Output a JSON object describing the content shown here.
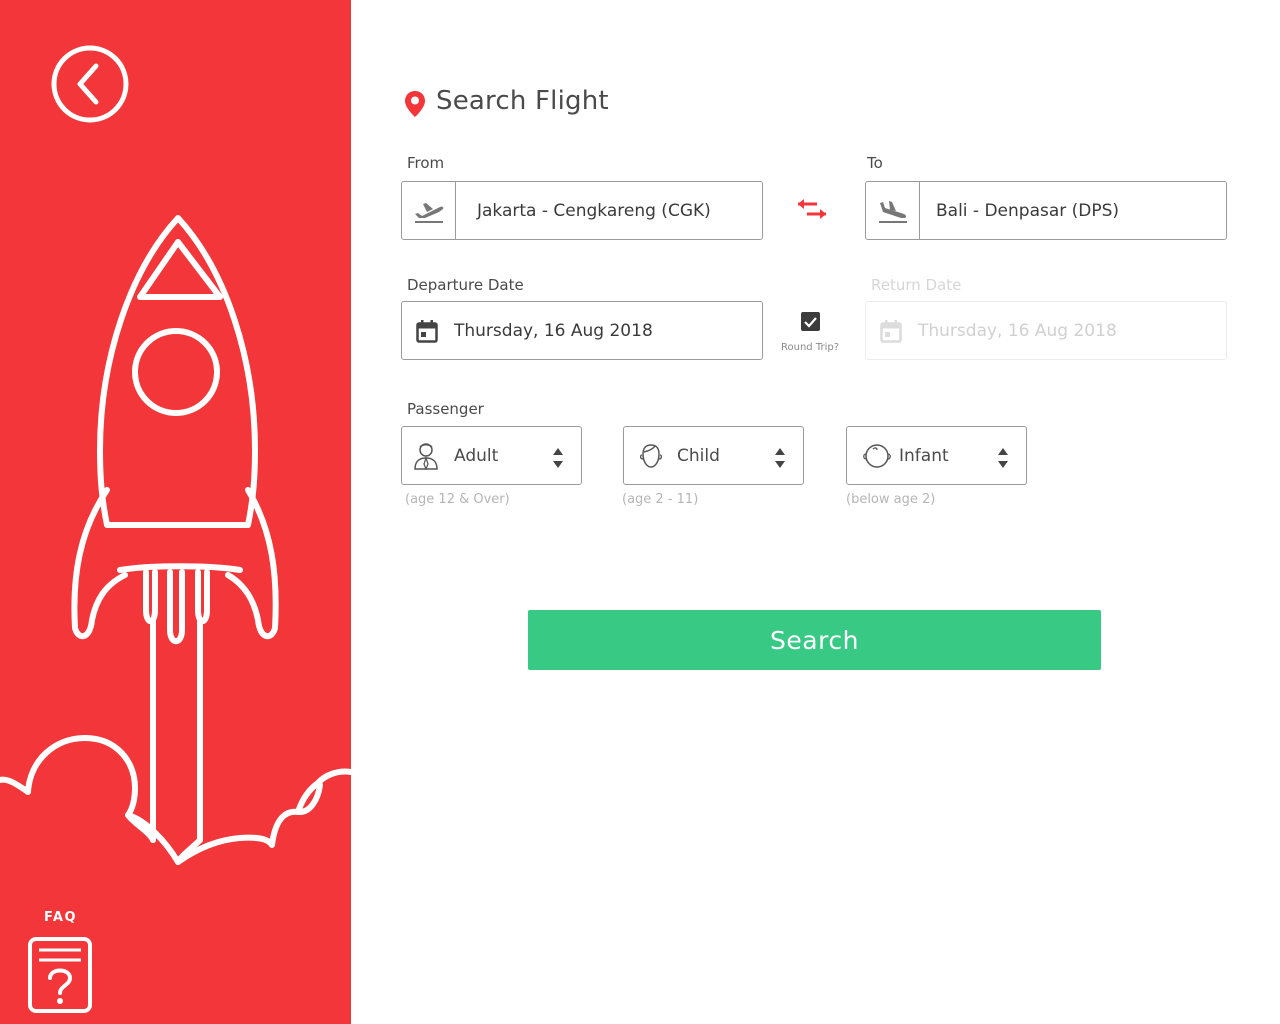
{
  "sidebar": {
    "faq_label": "FAQ"
  },
  "page": {
    "title": "Search Flight"
  },
  "from": {
    "label": "From",
    "value": "Jakarta - Cengkareng (CGK)"
  },
  "to": {
    "label": "To",
    "value": "Bali - Denpasar (DPS)"
  },
  "departure": {
    "label": "Departure Date",
    "value": "Thursday, 16 Aug 2018"
  },
  "round_trip": {
    "label": "Round Trip?",
    "checked": true
  },
  "return": {
    "label": "Return Date",
    "value": "Thursday, 16 Aug 2018",
    "disabled": true
  },
  "passenger": {
    "label": "Passenger",
    "adult": {
      "label": "Adult",
      "hint": "(age 12 & Over)"
    },
    "child": {
      "label": "Child",
      "hint": "(age 2 - 11)"
    },
    "infant": {
      "label": "Infant",
      "hint": "(below age 2)"
    }
  },
  "search_button": "Search",
  "colors": {
    "brand_red": "#f2363a",
    "search_green": "#38c985",
    "border": "#9b9b9b"
  },
  "icons": [
    "back-icon",
    "rocket-illustration",
    "faq-icon",
    "location-pin-icon",
    "takeoff-icon",
    "landing-icon",
    "swap-icon",
    "calendar-icon",
    "checkbox-icon",
    "adult-icon",
    "child-icon",
    "infant-icon",
    "stepper-icon"
  ]
}
